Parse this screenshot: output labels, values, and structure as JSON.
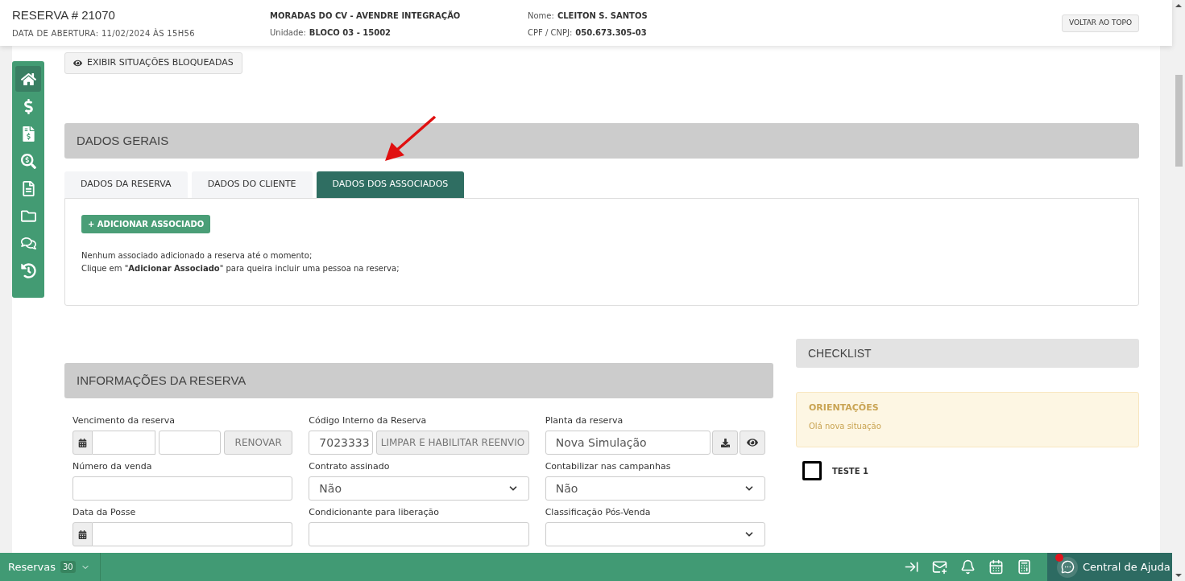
{
  "header": {
    "title": "RESERVA # 21070",
    "opened": "DATA DE ABERTURA: 11/02/2024 ÀS 15H56",
    "project": "MORADAS DO CV - AVENDRE INTEGRAÇÃO",
    "unit_label": "Unidade:",
    "unit": "BLOCO 03 - 15002",
    "name_label": "Nome:",
    "name": "CLEITON S. SANTOS",
    "doc_label": "CPF / CNPJ:",
    "doc": "050.673.305-03",
    "back_button": "VOLTAR AO TOPO"
  },
  "sidebar": {
    "items": [
      {
        "kind": "home",
        "selected": true
      },
      {
        "kind": "dollar",
        "selected": false
      },
      {
        "kind": "invoice",
        "selected": false
      },
      {
        "kind": "search-dollar",
        "selected": false
      },
      {
        "kind": "document",
        "selected": false
      },
      {
        "kind": "folder",
        "selected": false
      },
      {
        "kind": "chat",
        "selected": false
      },
      {
        "kind": "history",
        "selected": false
      }
    ]
  },
  "blocked_button": "EXIBIR SITUAÇÕES BLOQUEADAS",
  "general": {
    "title": "DADOS GERAIS",
    "tabs": [
      {
        "label": "DADOS DA RESERVA",
        "selected": false
      },
      {
        "label": "DADOS DO CLIENTE",
        "selected": false
      },
      {
        "label": "DADOS DOS ASSOCIADOS",
        "selected": true
      }
    ],
    "add_button": "+ ADICIONAR ASSOCIADO",
    "message": [
      "Nenhum associado adicionado a reserva até o momento;",
      "Clique em \"**Adicionar Associado**\" para queira incluir uma pessoa na reserva;"
    ]
  },
  "info": {
    "title": "INFORMAÇÕES DA RESERVA",
    "fields": [
      {
        "kind": "date-pair",
        "label": "Vencimento da reserva",
        "button": "RENOVAR"
      },
      {
        "kind": "code",
        "label": "Código Interno da Reserva",
        "value": "7023333",
        "button": "LIMPAR E HABILITAR REENVIO"
      },
      {
        "kind": "file",
        "label": "Planta da reserva",
        "value": "Nova Simulação"
      },
      {
        "kind": "text",
        "label": "Número da venda"
      },
      {
        "kind": "select",
        "label": "Contrato assinado",
        "value": "Não"
      },
      {
        "kind": "select",
        "label": "Contabilizar nas campanhas",
        "value": "Não"
      },
      {
        "kind": "date",
        "label": "Data da Posse"
      },
      {
        "kind": "text",
        "label": "Condicionante para liberação"
      },
      {
        "kind": "select",
        "label": "Classificação Pós-Venda"
      }
    ]
  },
  "checklist": {
    "title": "CHECKLIST",
    "notice_title": "ORIENTAÇÕES",
    "notice_text": "Olá nova situação",
    "items": [
      {
        "label": "TESTE 1",
        "checked": false
      }
    ]
  },
  "bottom_bar": {
    "reservations_label": "Reservas",
    "reservations_count": "30",
    "help": "Central de Ajuda",
    "help_alert": true
  }
}
